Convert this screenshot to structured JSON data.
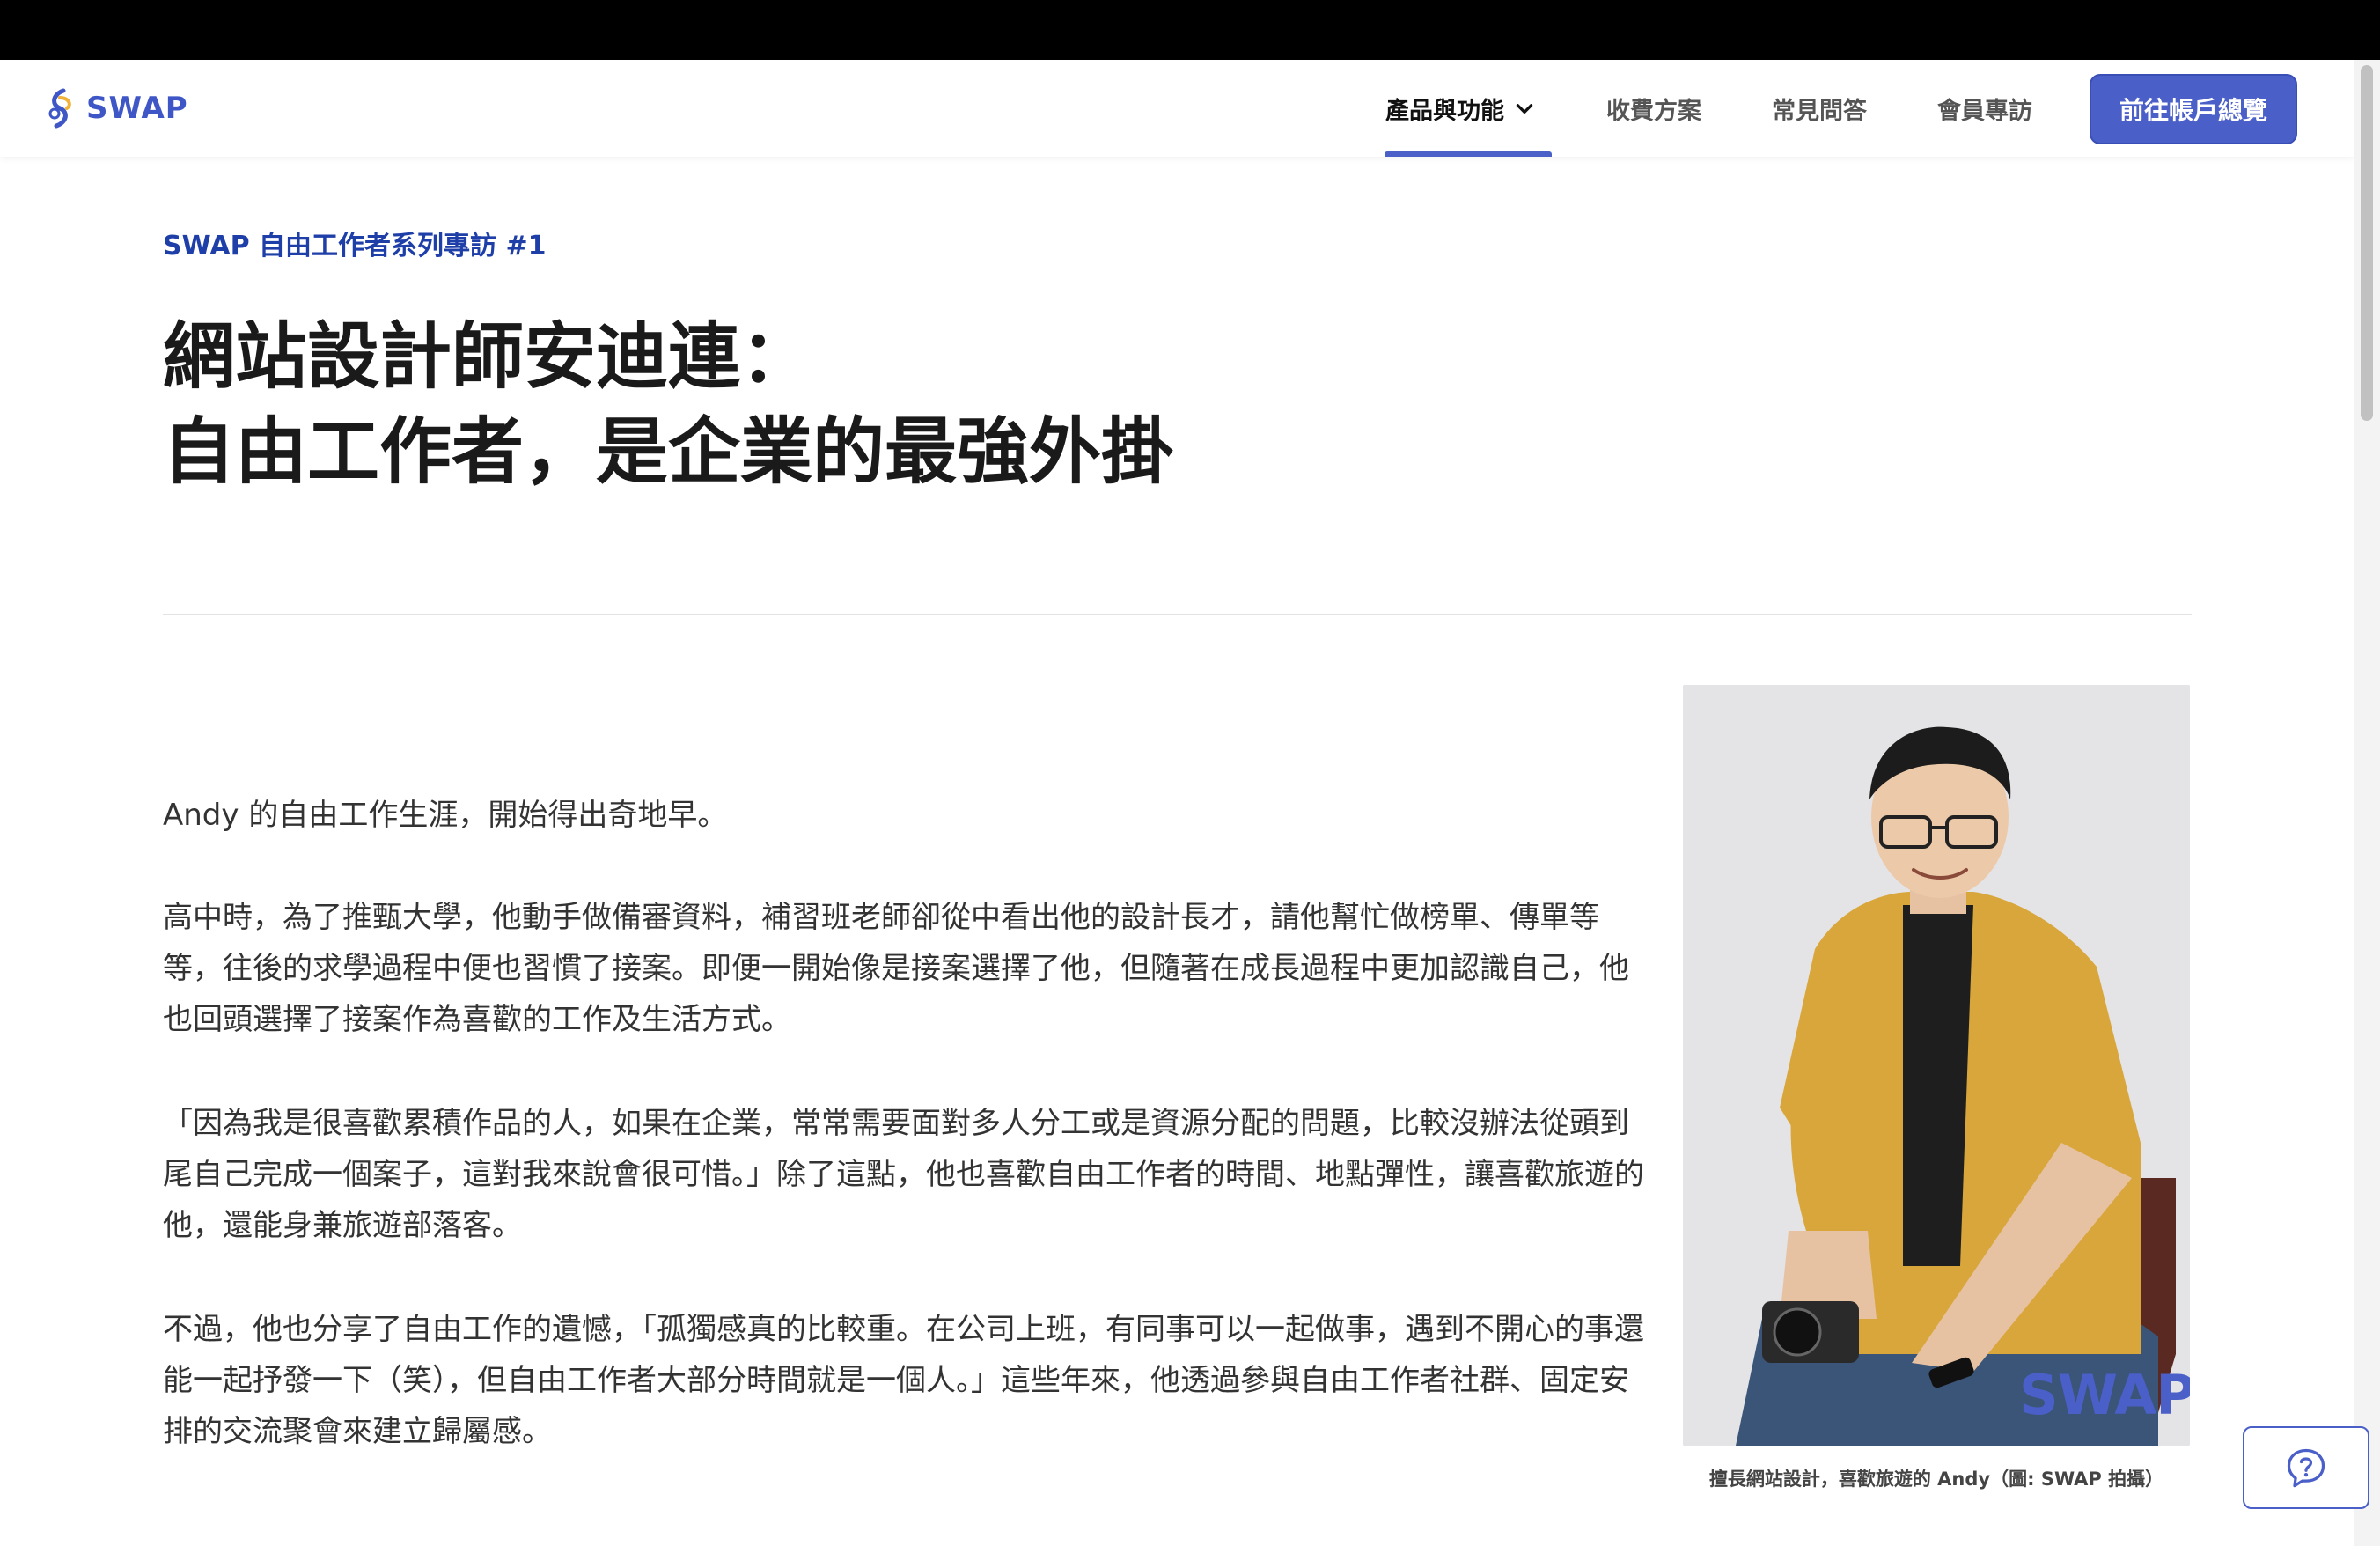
{
  "nav": {
    "logo_text": "SWAP",
    "items": [
      {
        "label": "產品與功能"
      },
      {
        "label": "收費方案"
      },
      {
        "label": "常見問答"
      },
      {
        "label": "會員專訪"
      }
    ],
    "cta_label": "前往帳戶總覽"
  },
  "article": {
    "eyebrow": "SWAP 自由工作者系列專訪 #1",
    "title_line1": "網站設計師安迪連：",
    "title_line2": "自由工作者，是企業的最強外掛",
    "paragraphs": [
      "Andy 的自由工作生涯，開始得出奇地早。",
      "高中時，為了推甄大學，他動手做備審資料，補習班老師卻從中看出他的設計長才，請他幫忙做榜單、傳單等等，往後的求學過程中便也習慣了接案。即便一開始像是接案選擇了他，但隨著在成長過程中更加認識自己，他也回頭選擇了接案作為喜歡的工作及生活方式。",
      "「因為我是很喜歡累積作品的人，如果在企業，常常需要面對多人分工或是資源分配的問題，比較沒辦法從頭到尾自己完成一個案子，這對我來說會很可惜。」除了這點，他也喜歡自由工作者的時間、地點彈性，讓喜歡旅遊的他，還能身兼旅遊部落客。",
      "不過，他也分享了自由工作的遺憾，「孤獨感真的比較重。在公司上班，有同事可以一起做事，遇到不開心的事還能一起抒發一下（笑），但自由工作者大部分時間就是一個人。」這些年來，他透過參與自由工作者社群、固定安排的交流聚會來建立歸屬感。"
    ],
    "photo_watermark": "SWAP",
    "photo_caption": "擅長網站設計，喜歡旅遊的 Andy（圖: SWAP 拍攝）"
  },
  "colors": {
    "brand": "#4a5fc8",
    "eyebrow": "#1e3ea8",
    "shirt": "#d9a63b"
  }
}
